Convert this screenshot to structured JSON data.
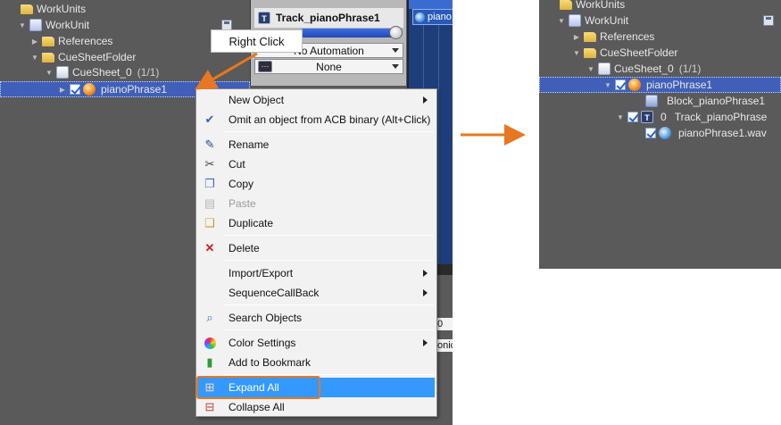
{
  "left_tree": {
    "workunits": "WorkUnits",
    "workunit": "WorkUnit",
    "references": "References",
    "cuesheetfolder": "CueSheetFolder",
    "cuesheet": "CueSheet_0",
    "cuesheet_count": "(1/1)",
    "cue": "pianoPhrase1"
  },
  "inspector": {
    "track_title": "Track_pianoPhrase1",
    "automation": "No Automation",
    "none": "None"
  },
  "timeline": {
    "clip_label": "piano"
  },
  "fragments": {
    "zero": "0",
    "onic": "onic"
  },
  "callout": {
    "text": "Right Click"
  },
  "context_menu": {
    "items": [
      {
        "label": "New Object"
      },
      {
        "label": "Omit an object from ACB binary (Alt+Click)"
      },
      {
        "label": "Rename"
      },
      {
        "label": "Cut"
      },
      {
        "label": "Copy"
      },
      {
        "label": "Paste"
      },
      {
        "label": "Duplicate"
      },
      {
        "label": "Delete"
      },
      {
        "label": "Import/Export"
      },
      {
        "label": "SequenceCallBack"
      },
      {
        "label": "Search Objects"
      },
      {
        "label": "Color Settings"
      },
      {
        "label": "Add to Bookmark"
      },
      {
        "label": "Expand All"
      },
      {
        "label": "Collapse All"
      }
    ]
  },
  "right_tree": {
    "workunits": "WorkUnits",
    "workunit": "WorkUnit",
    "references": "References",
    "cuesheetfolder": "CueSheetFolder",
    "cuesheet": "CueSheet_0",
    "cuesheet_count": "(1/1)",
    "cue": "pianoPhrase1",
    "block": "Block_pianoPhrase1",
    "track_index": "0",
    "track": "Track_pianoPhrase",
    "wave": "pianoPhrase1.wav"
  },
  "colors": {
    "panel_bg": "#5a5a5a",
    "selection": "#3f5fb8",
    "menu_highlight": "#3399ff",
    "annotation_orange": "#e87722"
  },
  "icons": [
    "folder-icon",
    "workunit-icon",
    "cuesheet-icon",
    "cue-icon",
    "checkbox-icon",
    "save-icon",
    "track-icon",
    "block-icon",
    "wave-icon",
    "rename-icon",
    "cut-icon",
    "copy-icon",
    "paste-icon",
    "duplicate-icon",
    "delete-icon",
    "search-icon",
    "color-icon",
    "bookmark-icon",
    "expand-all-icon",
    "collapse-all-icon"
  ]
}
